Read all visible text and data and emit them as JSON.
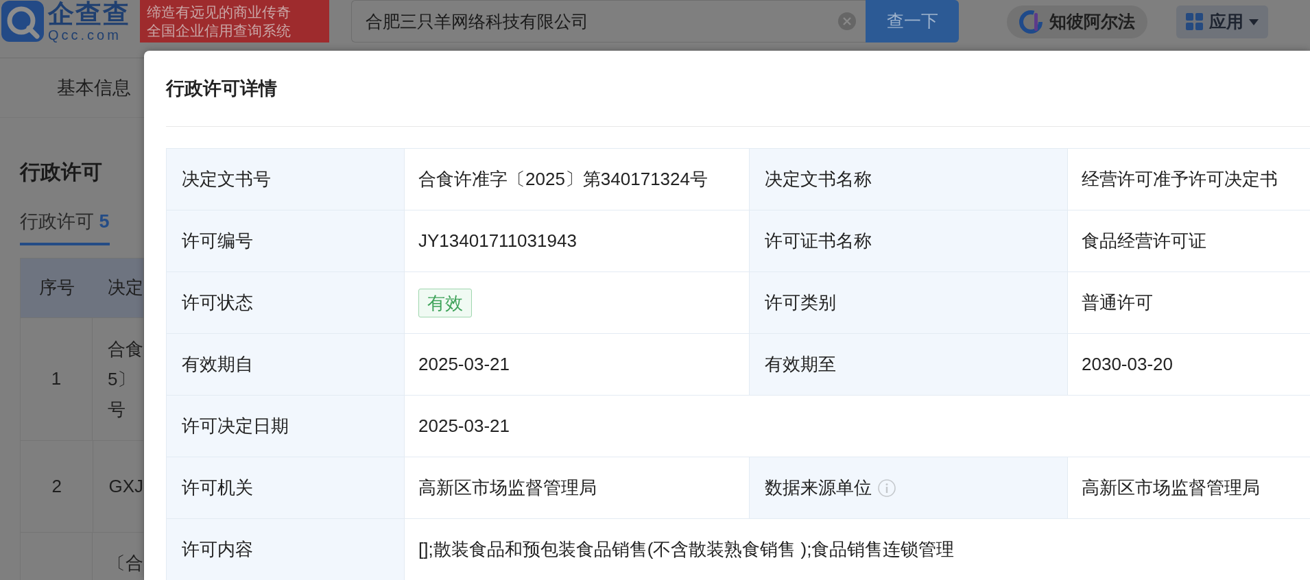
{
  "header": {
    "logo": {
      "brand": "企查查",
      "domain": "Qcc.com"
    },
    "slogan": [
      "缔造有远见的商业传奇",
      "全国企业信用查询系统"
    ],
    "search": {
      "value": "合肥三只羊网络科技有限公司"
    },
    "search_button": "查一下",
    "ai_button": "知彼阿尔法",
    "apps_button": "应用"
  },
  "page": {
    "nav_tab": "基本信息",
    "section_title": "行政许可",
    "tabs": [
      {
        "label": "行政许可",
        "count": "5",
        "selected": true
      }
    ],
    "table": {
      "columns": [
        "序号",
        "决定"
      ],
      "rows": [
        {
          "index": "1",
          "cell_lines": [
            "合食",
            "5〕",
            "号"
          ]
        },
        {
          "index": "2",
          "cell_lines": [
            "GXJ"
          ]
        },
        {
          "cell_lines": [
            "〔合"
          ]
        }
      ]
    }
  },
  "dialog": {
    "title": "行政许可详情",
    "rows": [
      {
        "cells": [
          {
            "label": "决定文书号",
            "value": "合食许准字〔2025〕第340171324号"
          },
          {
            "label": "决定文书名称",
            "value": "经营许可准予许可决定书"
          }
        ]
      },
      {
        "cells": [
          {
            "label": "许可编号",
            "value": "JY13401711031943"
          },
          {
            "label": "许可证书名称",
            "value": "食品经营许可证"
          }
        ]
      },
      {
        "cells": [
          {
            "label": "许可状态",
            "value": "有效",
            "kind": "badge"
          },
          {
            "label": "许可类别",
            "value": "普通许可"
          }
        ]
      },
      {
        "cells": [
          {
            "label": "有效期自",
            "value": "2025-03-21"
          },
          {
            "label": "有效期至",
            "value": "2030-03-20"
          }
        ]
      },
      {
        "cells": [
          {
            "label": "许可决定日期",
            "value": "2025-03-21"
          }
        ]
      },
      {
        "cells": [
          {
            "label": "许可机关",
            "value": "高新区市场监督管理局"
          },
          {
            "label": "数据来源单位",
            "value": "高新区市场监督管理局",
            "info": true
          }
        ]
      },
      {
        "cells": [
          {
            "label": "许可内容",
            "value": "[];散装食品和预包装食品销售(不含散装熟食销售 );食品销售连锁管理"
          }
        ]
      }
    ]
  }
}
